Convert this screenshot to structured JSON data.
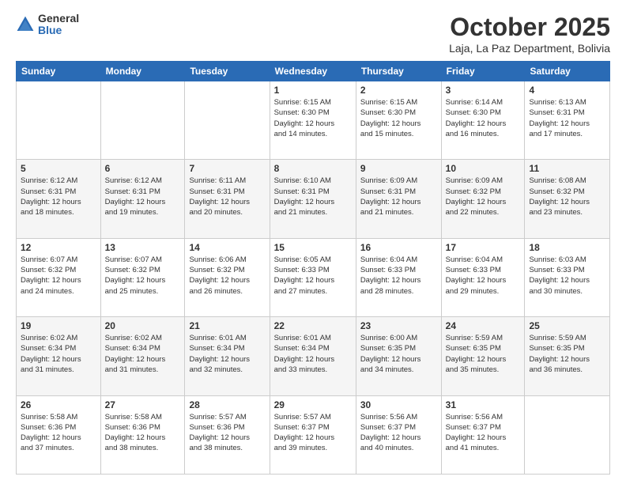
{
  "header": {
    "logo_general": "General",
    "logo_blue": "Blue",
    "month_title": "October 2025",
    "location": "Laja, La Paz Department, Bolivia"
  },
  "calendar": {
    "days_of_week": [
      "Sunday",
      "Monday",
      "Tuesday",
      "Wednesday",
      "Thursday",
      "Friday",
      "Saturday"
    ],
    "weeks": [
      [
        {
          "day": "",
          "info": ""
        },
        {
          "day": "",
          "info": ""
        },
        {
          "day": "",
          "info": ""
        },
        {
          "day": "1",
          "info": "Sunrise: 6:15 AM\nSunset: 6:30 PM\nDaylight: 12 hours\nand 14 minutes."
        },
        {
          "day": "2",
          "info": "Sunrise: 6:15 AM\nSunset: 6:30 PM\nDaylight: 12 hours\nand 15 minutes."
        },
        {
          "day": "3",
          "info": "Sunrise: 6:14 AM\nSunset: 6:30 PM\nDaylight: 12 hours\nand 16 minutes."
        },
        {
          "day": "4",
          "info": "Sunrise: 6:13 AM\nSunset: 6:31 PM\nDaylight: 12 hours\nand 17 minutes."
        }
      ],
      [
        {
          "day": "5",
          "info": "Sunrise: 6:12 AM\nSunset: 6:31 PM\nDaylight: 12 hours\nand 18 minutes."
        },
        {
          "day": "6",
          "info": "Sunrise: 6:12 AM\nSunset: 6:31 PM\nDaylight: 12 hours\nand 19 minutes."
        },
        {
          "day": "7",
          "info": "Sunrise: 6:11 AM\nSunset: 6:31 PM\nDaylight: 12 hours\nand 20 minutes."
        },
        {
          "day": "8",
          "info": "Sunrise: 6:10 AM\nSunset: 6:31 PM\nDaylight: 12 hours\nand 21 minutes."
        },
        {
          "day": "9",
          "info": "Sunrise: 6:09 AM\nSunset: 6:31 PM\nDaylight: 12 hours\nand 21 minutes."
        },
        {
          "day": "10",
          "info": "Sunrise: 6:09 AM\nSunset: 6:32 PM\nDaylight: 12 hours\nand 22 minutes."
        },
        {
          "day": "11",
          "info": "Sunrise: 6:08 AM\nSunset: 6:32 PM\nDaylight: 12 hours\nand 23 minutes."
        }
      ],
      [
        {
          "day": "12",
          "info": "Sunrise: 6:07 AM\nSunset: 6:32 PM\nDaylight: 12 hours\nand 24 minutes."
        },
        {
          "day": "13",
          "info": "Sunrise: 6:07 AM\nSunset: 6:32 PM\nDaylight: 12 hours\nand 25 minutes."
        },
        {
          "day": "14",
          "info": "Sunrise: 6:06 AM\nSunset: 6:32 PM\nDaylight: 12 hours\nand 26 minutes."
        },
        {
          "day": "15",
          "info": "Sunrise: 6:05 AM\nSunset: 6:33 PM\nDaylight: 12 hours\nand 27 minutes."
        },
        {
          "day": "16",
          "info": "Sunrise: 6:04 AM\nSunset: 6:33 PM\nDaylight: 12 hours\nand 28 minutes."
        },
        {
          "day": "17",
          "info": "Sunrise: 6:04 AM\nSunset: 6:33 PM\nDaylight: 12 hours\nand 29 minutes."
        },
        {
          "day": "18",
          "info": "Sunrise: 6:03 AM\nSunset: 6:33 PM\nDaylight: 12 hours\nand 30 minutes."
        }
      ],
      [
        {
          "day": "19",
          "info": "Sunrise: 6:02 AM\nSunset: 6:34 PM\nDaylight: 12 hours\nand 31 minutes."
        },
        {
          "day": "20",
          "info": "Sunrise: 6:02 AM\nSunset: 6:34 PM\nDaylight: 12 hours\nand 31 minutes."
        },
        {
          "day": "21",
          "info": "Sunrise: 6:01 AM\nSunset: 6:34 PM\nDaylight: 12 hours\nand 32 minutes."
        },
        {
          "day": "22",
          "info": "Sunrise: 6:01 AM\nSunset: 6:34 PM\nDaylight: 12 hours\nand 33 minutes."
        },
        {
          "day": "23",
          "info": "Sunrise: 6:00 AM\nSunset: 6:35 PM\nDaylight: 12 hours\nand 34 minutes."
        },
        {
          "day": "24",
          "info": "Sunrise: 5:59 AM\nSunset: 6:35 PM\nDaylight: 12 hours\nand 35 minutes."
        },
        {
          "day": "25",
          "info": "Sunrise: 5:59 AM\nSunset: 6:35 PM\nDaylight: 12 hours\nand 36 minutes."
        }
      ],
      [
        {
          "day": "26",
          "info": "Sunrise: 5:58 AM\nSunset: 6:36 PM\nDaylight: 12 hours\nand 37 minutes."
        },
        {
          "day": "27",
          "info": "Sunrise: 5:58 AM\nSunset: 6:36 PM\nDaylight: 12 hours\nand 38 minutes."
        },
        {
          "day": "28",
          "info": "Sunrise: 5:57 AM\nSunset: 6:36 PM\nDaylight: 12 hours\nand 38 minutes."
        },
        {
          "day": "29",
          "info": "Sunrise: 5:57 AM\nSunset: 6:37 PM\nDaylight: 12 hours\nand 39 minutes."
        },
        {
          "day": "30",
          "info": "Sunrise: 5:56 AM\nSunset: 6:37 PM\nDaylight: 12 hours\nand 40 minutes."
        },
        {
          "day": "31",
          "info": "Sunrise: 5:56 AM\nSunset: 6:37 PM\nDaylight: 12 hours\nand 41 minutes."
        },
        {
          "day": "",
          "info": ""
        }
      ]
    ]
  }
}
